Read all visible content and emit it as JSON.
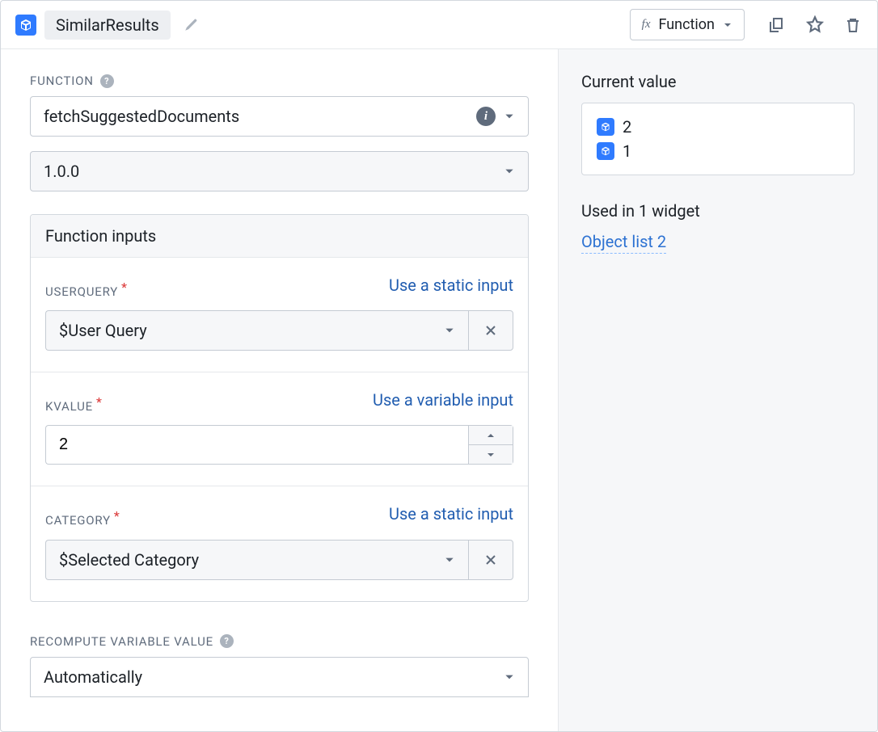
{
  "header": {
    "title": "SimilarResults",
    "type_label": "Function"
  },
  "function_section_label": "FUNCTION",
  "function_name": "fetchSuggestedDocuments",
  "function_version": "1.0.0",
  "inputs_header": "Function inputs",
  "inputs": {
    "userquery": {
      "label": "USERQUERY",
      "action": "Use a static input",
      "value": "$User Query"
    },
    "kvalue": {
      "label": "KVALUE",
      "action": "Use a variable input",
      "value": "2"
    },
    "category": {
      "label": "CATEGORY",
      "action": "Use a static input",
      "value": "$Selected Category"
    }
  },
  "recompute": {
    "label": "RECOMPUTE VARIABLE VALUE",
    "value": "Automatically"
  },
  "side": {
    "current_value_label": "Current value",
    "values": {
      "v0": "2",
      "v1": "1"
    },
    "used_in_label": "Used in 1 widget",
    "widget_link": "Object list 2"
  }
}
